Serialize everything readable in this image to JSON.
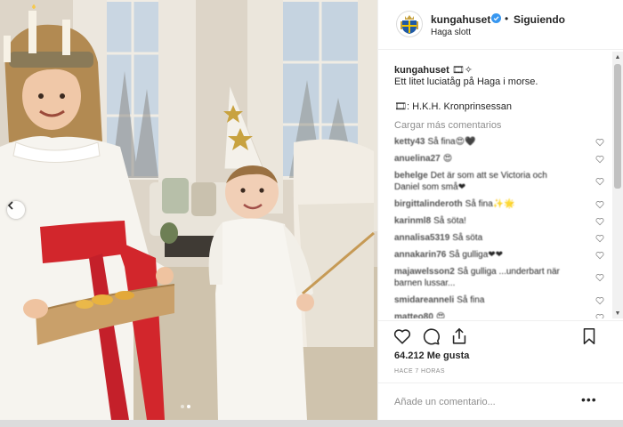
{
  "post": {
    "username": "kungahuset",
    "follow_status": "Siguiendo",
    "separator": "•",
    "location": "Haga slott",
    "caption_user": "kungahuset",
    "caption_emoji": "🎞✧",
    "caption_line1": "Ett litet luciatåg på Haga i morse.",
    "caption_line2": "🎞: H.K.H. Kronprinsessan",
    "load_more": "Cargar más comentarios",
    "likes": "64.212 Me gusta",
    "time": "HACE 7 HORAS",
    "comment_placeholder": "Añade un comentario...",
    "more": "•••"
  },
  "comments": [
    {
      "user": "ketty43",
      "text": "Så fina😍🖤"
    },
    {
      "user": "anuelina27",
      "text": "😍"
    },
    {
      "user": "behelge",
      "text": "Det är som att se Victoria och"
    },
    {
      "user": "",
      "text": "Daniel som små❤"
    },
    {
      "user": "birgittalinderoth",
      "text": "Så fina✨🌟"
    },
    {
      "user": "karinml8",
      "text": "Så söta!"
    },
    {
      "user": "annalisa5319",
      "text": "Så söta"
    },
    {
      "user": "annakarin76",
      "text": "Så gulliga❤❤"
    },
    {
      "user": "majawelsson2",
      "text": "Så gulliga ...underbart när"
    },
    {
      "user": "",
      "text": "barnen lussar..."
    },
    {
      "user": "smidareanneli",
      "text": "Så fina"
    },
    {
      "user": "matteo80",
      "text": "😍"
    }
  ],
  "icons": {
    "verified": "verified-badge-icon",
    "heart": "heart-icon",
    "comment": "comment-icon",
    "share": "share-icon",
    "bookmark": "bookmark-icon",
    "carousel_prev": "chevron-left-icon"
  },
  "colors": {
    "verified_blue": "#3897f0",
    "text": "#262626",
    "muted": "#8e8e8e",
    "divider": "#efefef",
    "sash_red": "#d2262c"
  }
}
